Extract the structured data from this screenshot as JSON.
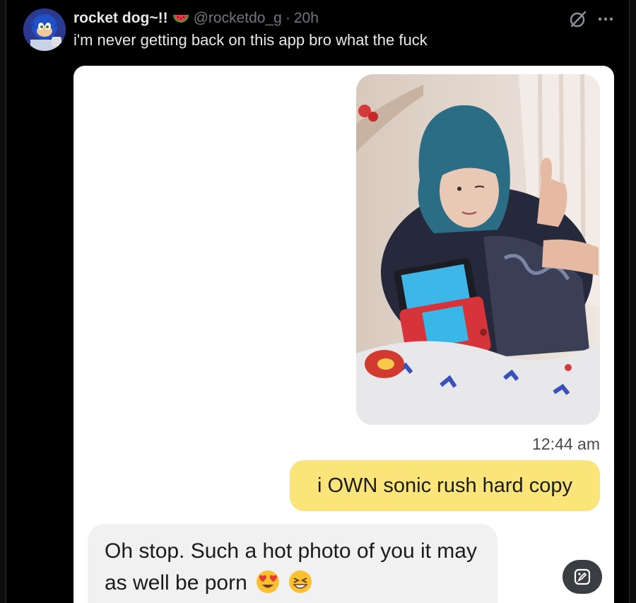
{
  "tweet": {
    "display_name": "rocket dog~!!",
    "handle": "@rocketdo_g",
    "separator": "·",
    "time": "20h",
    "text": "i'm never getting back on this app bro what the fuck",
    "icons": {
      "avatar": "sonic-avatar",
      "badge": "watermelon-icon",
      "grok": "grok-icon",
      "more": "more-icon",
      "edit": "edit-image-icon"
    }
  },
  "chat": {
    "timestamp": "12:44 am",
    "outgoing_message": "i OWN sonic rush hard copy",
    "incoming_message": "Oh stop. Such a hot photo of you it may as well be porn",
    "incoming_emojis": [
      "heart-eyes-emoji",
      "grinning-squint-emoji"
    ]
  },
  "colors": {
    "background": "#000000",
    "primary_text": "#e7e9ea",
    "secondary_text": "#71767b",
    "outgoing_bubble": "#fbe47a",
    "incoming_bubble": "#f1f1f1"
  }
}
